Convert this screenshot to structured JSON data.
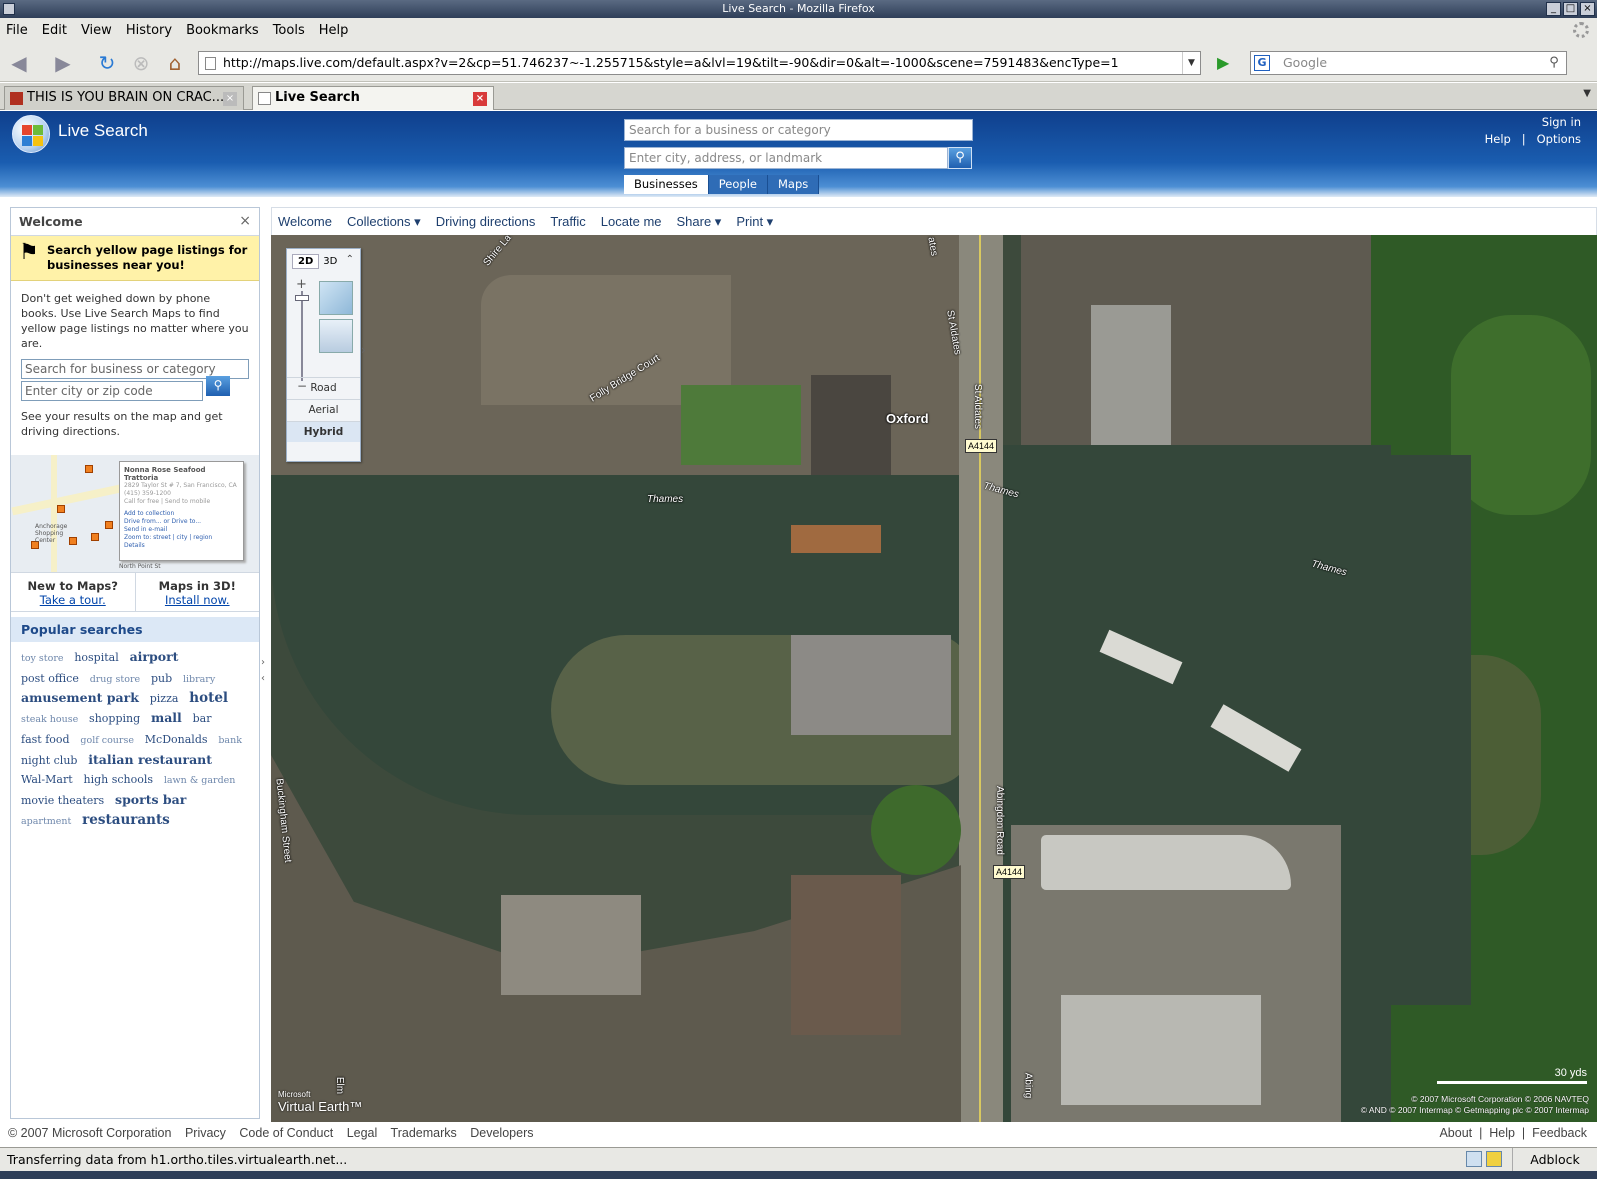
{
  "window": {
    "title": "Live Search - Mozilla Firefox"
  },
  "menu": [
    "File",
    "Edit",
    "View",
    "History",
    "Bookmarks",
    "Tools",
    "Help"
  ],
  "navigation": {
    "url": "http://maps.live.com/default.aspx?v=2&cp=51.746237~-1.255715&style=a&lvl=19&tilt=-90&dir=0&alt=-1000&scene=7591483&encType=1",
    "search_placeholder": "Google"
  },
  "tabs": [
    {
      "label": "THIS IS YOU BRAIN ON CRAC...",
      "active": false
    },
    {
      "label": "Live Search",
      "active": true
    }
  ],
  "livesearch": {
    "brand": "Live Search",
    "business_placeholder": "Search for a business or category",
    "location_placeholder": "Enter city, address, or landmark",
    "search_tabs": [
      "Businesses",
      "People",
      "Maps"
    ],
    "sign_in": "Sign in",
    "help": "Help",
    "separator": "|",
    "options": "Options"
  },
  "sidebar": {
    "title": "Welcome",
    "close": "×",
    "promo_heading": "Search yellow page listings for businesses near you!",
    "promo_body": "Don't get weighed down by phone books. Use Live Search Maps to find yellow page listings no matter where you are.",
    "business_placeholder": "Search for business or category",
    "location_placeholder": "Enter city or zip code",
    "result_note": "See your results on the map and get driving directions.",
    "minimap_card": {
      "title": "Nonna Rose Seafood Trattoria",
      "address": "2829 Taylor St # 7, San Francisco, CA",
      "phone": "(415) 359-1200",
      "call": "Call for free | Send to mobile",
      "actions": [
        "Add to collection",
        "Drive from... or Drive to...",
        "Send in e-mail",
        "Zoom to: street | city | region",
        "Details"
      ],
      "map_label": "Anchorage Shopping Center",
      "road_label": "North Point St"
    },
    "new_to_maps": "New to Maps?",
    "take_tour": "Take a tour.",
    "maps_3d": "Maps in 3D!",
    "install": "Install now.",
    "popular_heading": "Popular searches",
    "popular": [
      {
        "text": "toy store",
        "w": 1
      },
      {
        "text": "hospital",
        "w": 2
      },
      {
        "text": "airport",
        "w": 3
      },
      {
        "text": "post office",
        "w": 2
      },
      {
        "text": "drug store",
        "w": 1
      },
      {
        "text": "pub",
        "w": 2
      },
      {
        "text": "library",
        "w": 1
      },
      {
        "text": "amusement park",
        "w": 3
      },
      {
        "text": "pizza",
        "w": 2
      },
      {
        "text": "hotel",
        "w": 4
      },
      {
        "text": "steak house",
        "w": 1
      },
      {
        "text": "shopping",
        "w": 2
      },
      {
        "text": "mall",
        "w": 3
      },
      {
        "text": "bar",
        "w": 2
      },
      {
        "text": "fast food",
        "w": 2
      },
      {
        "text": "golf course",
        "w": 1
      },
      {
        "text": "McDonalds",
        "w": 2
      },
      {
        "text": "bank",
        "w": 1
      },
      {
        "text": "night club",
        "w": 2
      },
      {
        "text": "italian restaurant",
        "w": 3
      },
      {
        "text": "Wal-Mart",
        "w": 2
      },
      {
        "text": "high schools",
        "w": 2
      },
      {
        "text": "lawn & garden",
        "w": 1
      },
      {
        "text": "movie theaters",
        "w": 2
      },
      {
        "text": "sports bar",
        "w": 3
      },
      {
        "text": "apartment",
        "w": 1
      },
      {
        "text": "restaurants",
        "w": 4
      }
    ]
  },
  "toolbar": [
    "Welcome",
    "Collections ▾",
    "Driving directions",
    "Traffic",
    "Locate me",
    "Share ▾",
    "Print ▾"
  ],
  "map": {
    "view_tabs": [
      "2D",
      "3D"
    ],
    "modes": [
      "Road",
      "Aerial",
      "Hybrid"
    ],
    "selected_mode": "Hybrid",
    "labels": {
      "oxford": "Oxford",
      "thames": "Thames",
      "folly_bridge_court": "Folly Bridge Court",
      "st_aldates": "St Aldates",
      "abingdon_road": "Abingdon Road",
      "abingdon_short": "Abing",
      "buckingham_street": "Buckingham Street",
      "shire_lake": "Shire La",
      "a4144": "A4144",
      "elm": "Elm",
      "ates": "ates"
    },
    "scale": "30 yds",
    "copyright_line1": "© 2007 Microsoft Corporation   © 2006 NAVTEQ",
    "copyright_line2": "© AND   © 2007 Intermap   © Getmapping plc   © 2007 Intermap",
    "logo_small": "Microsoft",
    "logo_main": "Virtual Earth™"
  },
  "footer": {
    "copyright": "© 2007 Microsoft Corporation",
    "links": [
      "Privacy",
      "Code of Conduct",
      "Legal",
      "Trademarks",
      "Developers"
    ],
    "right_links": "About  |  Help  |  Feedback"
  },
  "status": {
    "text": "Transferring data from h1.ortho.tiles.virtualearth.net...",
    "adblock": "Adblock"
  }
}
